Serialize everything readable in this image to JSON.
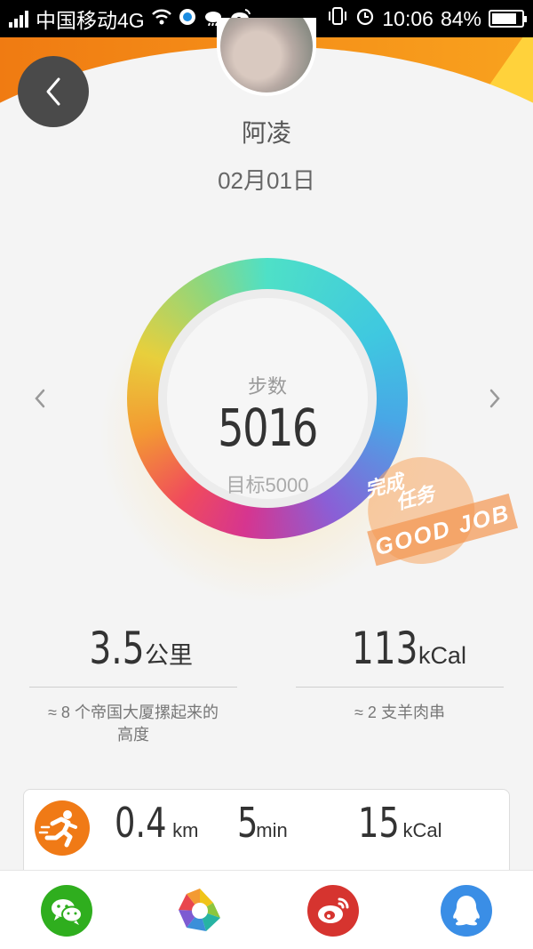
{
  "status_bar": {
    "carrier": "中国移动4G",
    "time": "10:06",
    "battery": "84%",
    "battery_level": 0.84
  },
  "header": {
    "back_icon": "chevron-left-icon",
    "user_name": "阿凌",
    "date": "02月01日"
  },
  "ring": {
    "label": "步数",
    "steps": "5016",
    "goal": "目标5000",
    "progress": 1.0
  },
  "stamp": {
    "line1": "完成",
    "line2": "任务",
    "text": "GOOD JOB"
  },
  "stats": {
    "distance": {
      "value": "3.5",
      "unit": "公里",
      "desc_line1": "≈ 8  个帝国大厦摞起来的",
      "desc_line2": "高度"
    },
    "calories": {
      "value": "113",
      "unit": "kCal",
      "desc_line1": "≈ 2 支羊肉串"
    }
  },
  "activity": {
    "icon": "running-icon",
    "distance": {
      "value": "0.4",
      "unit": "km"
    },
    "duration": {
      "value": "5",
      "unit": "min"
    },
    "calories": {
      "value": "15",
      "unit": "kCal"
    }
  },
  "share": {
    "items": [
      "wechat-icon",
      "moments-icon",
      "weibo-icon",
      "qq-icon"
    ]
  },
  "colors": {
    "accent": "#f07a16",
    "wechat": "#2fae1e",
    "weibo": "#d6342f",
    "qq": "#3a8ee6"
  }
}
